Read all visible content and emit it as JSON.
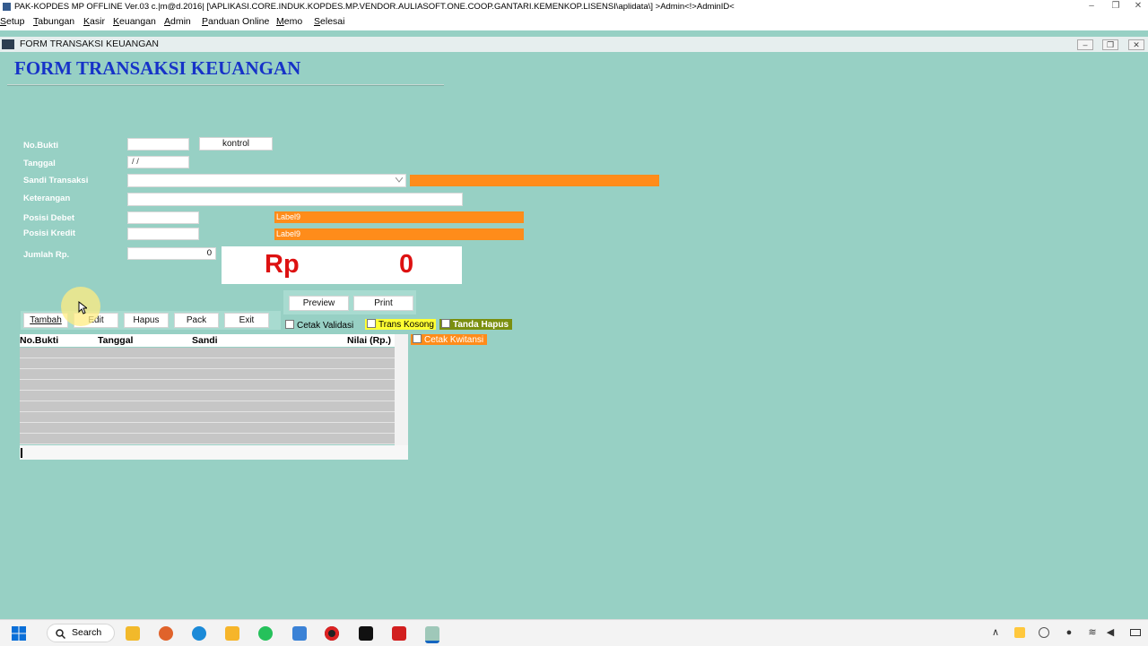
{
  "window": {
    "title": "PAK-KOPDES MP OFFLINE Ver.03 c.|m@d.2016| [\\APLIKASI.CORE.INDUK.KOPDES.MP.VENDOR.AULIASOFT.ONE.COOP.GANTARI.KEMENKOP.LISENSI\\aplidata\\] >Admin<!>AdminID<",
    "controls": {
      "minimize": "–",
      "restore": "❐",
      "close": "✕"
    }
  },
  "menu": [
    "Setup",
    "Tabungan",
    "Kasir",
    "Keuangan",
    "Admin",
    "Panduan Online",
    "Memo",
    "Selesai"
  ],
  "child_window": {
    "title": "FORM TRANSAKSI KEUANGAN",
    "controls": {
      "minimize": "–",
      "restore": "❐",
      "close": "✕"
    }
  },
  "form": {
    "heading": "FORM TRANSAKSI KEUANGAN",
    "labels": {
      "no_bukti": "No.Bukti",
      "tanggal": "Tanggal",
      "sandi": "Sandi Transaksi",
      "keterangan": "Keterangan",
      "posisi_debet": "Posisi Debet",
      "posisi_kredit": "Posisi Kredit",
      "jumlah": "Jumlah Rp."
    },
    "values": {
      "no_bukti": "",
      "tanggal": "/ /",
      "sandi": "",
      "keterangan": "",
      "posisi_debet": "",
      "posisi_kredit": "",
      "jumlah": "0"
    },
    "kontrol_button": "kontrol",
    "debet_label": "Label9",
    "kredit_label": "Label9",
    "display": {
      "currency": "Rp",
      "amount": "0"
    },
    "dropdown_icon": "chevron-down-icon"
  },
  "actions": [
    "Tambah",
    "Edit",
    "Hapus",
    "Pack",
    "Exit"
  ],
  "print_buttons": {
    "preview": "Preview",
    "print": "Print"
  },
  "checks": {
    "cetak_validasi": "Cetak Validasi",
    "trans_kosong": "Trans Kosong",
    "tanda_hapus": "Tanda Hapus",
    "cetak_kwitansi": "Cetak Kwitansi"
  },
  "grid": {
    "columns": [
      "No.Bukti",
      "Tanggal",
      "Sandi",
      "Nilai (Rp.)"
    ]
  },
  "taskbar": {
    "search_label": "Search",
    "icons": [
      "windows-start-icon",
      "search-icon",
      "file-explorer-icon",
      "browser-icon",
      "edge-icon",
      "app-icon",
      "whatsapp-icon",
      "notepad-icon",
      "record-icon",
      "capcut-icon",
      "pdf-icon",
      "active-app-icon"
    ],
    "tray": {
      "chevron": "∧",
      "wifi": "≋",
      "volume": "◀",
      "mic": "●"
    }
  },
  "colors": {
    "background": "#97d0c4",
    "heading": "#1632c8",
    "amount": "#dd1111",
    "orange": "#ff8c1a",
    "yellow": "#ffff33",
    "olive": "#7b8f0f"
  }
}
